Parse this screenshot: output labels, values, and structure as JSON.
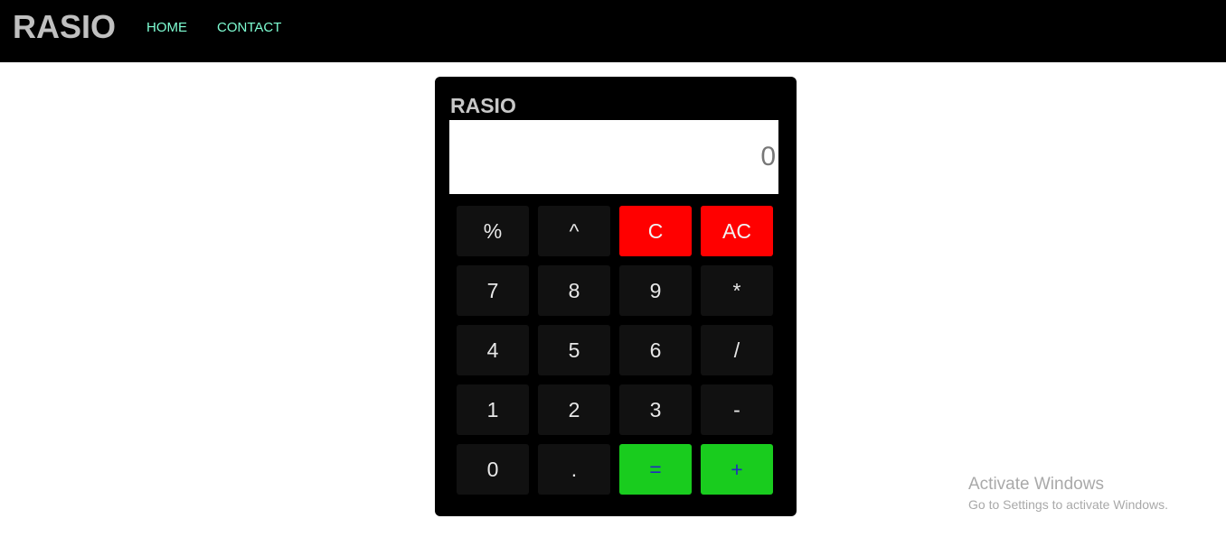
{
  "navbar": {
    "brand": "RASIO",
    "links": [
      {
        "label": "HOME"
      },
      {
        "label": "CONTACT"
      }
    ]
  },
  "calculator": {
    "title": "RASIO",
    "display": {
      "placeholder": "0",
      "value": ""
    },
    "keys": [
      {
        "label": "%"
      },
      {
        "label": "^"
      },
      {
        "label": "C"
      },
      {
        "label": "AC"
      },
      {
        "label": "7"
      },
      {
        "label": "8"
      },
      {
        "label": "9"
      },
      {
        "label": "*"
      },
      {
        "label": "4"
      },
      {
        "label": "5"
      },
      {
        "label": "6"
      },
      {
        "label": "/"
      },
      {
        "label": "1"
      },
      {
        "label": "2"
      },
      {
        "label": "3"
      },
      {
        "label": "-"
      },
      {
        "label": "0"
      },
      {
        "label": "."
      },
      {
        "label": "="
      },
      {
        "label": "+"
      }
    ]
  },
  "watermark": {
    "title": "Activate Windows",
    "subtitle": "Go to Settings to activate Windows."
  },
  "colors": {
    "navbar_bg": "#000000",
    "nav_link": "#7fffd4",
    "clear_keys": "#ff0000",
    "action_keys": "#19cc1e",
    "key_bg": "#111111"
  }
}
